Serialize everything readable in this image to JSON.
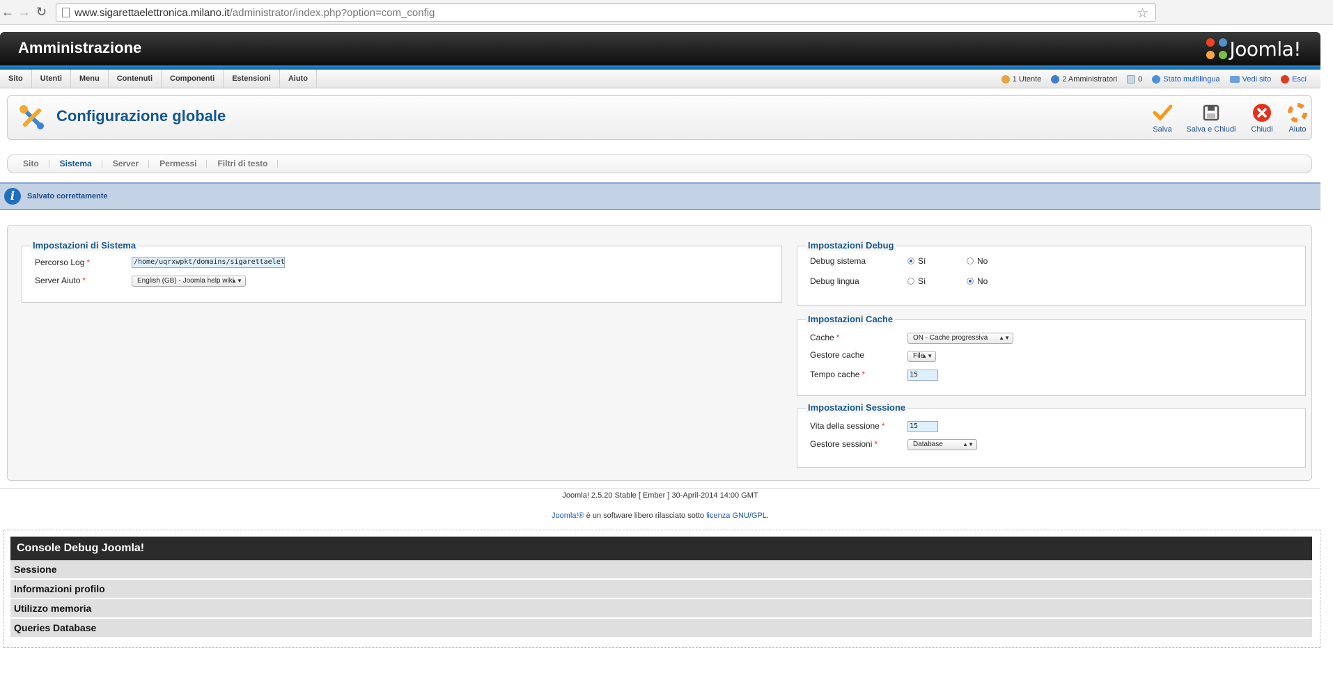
{
  "browser": {
    "url_host": "www.sigarettaelettronica.milano.it",
    "url_path": "/administrator/index.php?option=com_config"
  },
  "header": {
    "title": "Amministrazione",
    "logo_text": "Joomla!"
  },
  "menu": [
    {
      "label": "Sito"
    },
    {
      "label": "Utenti"
    },
    {
      "label": "Menu"
    },
    {
      "label": "Contenuti"
    },
    {
      "label": "Componenti"
    },
    {
      "label": "Estensioni"
    },
    {
      "label": "Aiuto"
    }
  ],
  "status": {
    "users": "1 Utente",
    "admins": "2 Amministratori",
    "messages": "0",
    "multilang": "Stato multilingua",
    "view_site": "Vedi sito",
    "logout": "Esci"
  },
  "toolbar": {
    "page_title": "Configurazione globale",
    "save": "Salva",
    "save_close": "Salva e Chiudi",
    "close": "Chiudi",
    "help": "Aiuto"
  },
  "tabs": [
    {
      "label": "Sito"
    },
    {
      "label": "Sistema"
    },
    {
      "label": "Server"
    },
    {
      "label": "Permessi"
    },
    {
      "label": "Filtri di testo"
    }
  ],
  "message": "Salvato correttamente",
  "system_settings": {
    "legend": "Impostazioni di Sistema",
    "log_path_label": "Percorso Log",
    "log_path_value": "/home/uqrxwpkt/domains/sigarettaelettron",
    "help_server_label": "Server Aiuto",
    "help_server_value": "English (GB) - Joomla help wiki"
  },
  "debug_settings": {
    "legend": "Impostazioni Debug",
    "debug_system_label": "Debug sistema",
    "debug_lang_label": "Debug lingua",
    "yes": "Sì",
    "no": "No",
    "debug_system": "yes",
    "debug_lang": "no"
  },
  "cache_settings": {
    "legend": "Impostazioni Cache",
    "cache_label": "Cache",
    "cache_value": "ON - Cache progressiva",
    "handler_label": "Gestore cache",
    "handler_value": "File",
    "time_label": "Tempo cache",
    "time_value": "15"
  },
  "session_settings": {
    "legend": "Impostazioni Sessione",
    "lifetime_label": "Vita della sessione",
    "lifetime_value": "15",
    "handler_label": "Gestore sessioni",
    "handler_value": "Database"
  },
  "footer": {
    "version": "Joomla! 2.5.20 Stable [ Ember ] 30-April-2014 14:00 GMT",
    "joomla_link": "Joomla!®",
    "license_text": " è un software libero rilasciato sotto ",
    "license_link": "licenza GNU/GPL",
    "license_end": "."
  },
  "debug_console": {
    "title": "Console Debug Joomla!",
    "sections": [
      "Sessione",
      "Informazioni profilo",
      "Utilizzo memoria",
      "Queries Database"
    ]
  },
  "colors": {
    "brand_blue": "#14578f",
    "link_blue": "#1b57b1",
    "message_bg": "#c3d2e5",
    "required": "#ee3333"
  }
}
